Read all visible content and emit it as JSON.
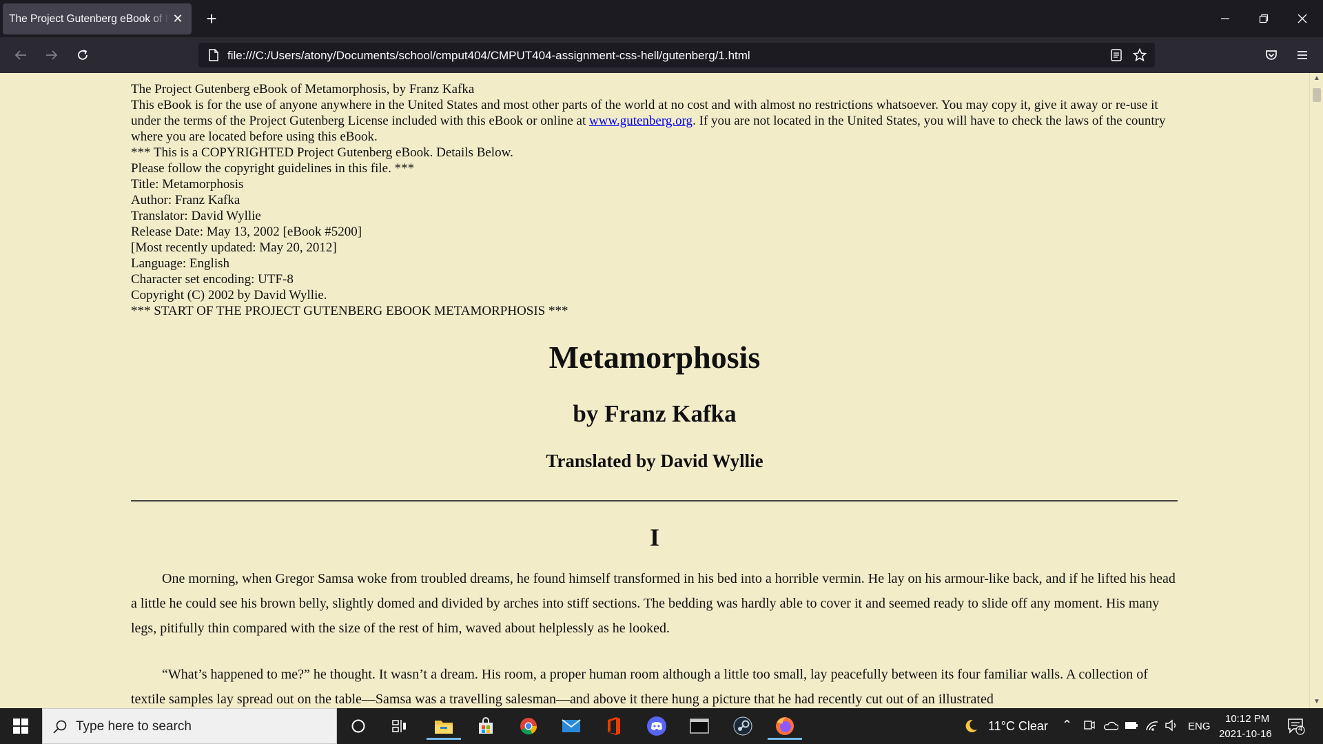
{
  "browser": {
    "tab_title": "The Project Gutenberg eBook of Metamorphosis, by Franz Kafka",
    "url": "file:///C:/Users/atony/Documents/school/cmput404/CMPUT404-assignment-css-hell/gutenberg/1.html"
  },
  "header": {
    "line1": "The Project Gutenberg eBook of Metamorphosis, by Franz Kafka",
    "license_before_link": "This eBook is for the use of anyone anywhere in the United States and most other parts of the world at no cost and with almost no restrictions whatsoever. You may copy it, give it away or re-use it under the terms of the Project Gutenberg License included with this eBook or online at ",
    "license_link": "www.gutenberg.org",
    "license_after_link": ". If you are not located in the United States, you will have to check the laws of the country where you are located before using this eBook.",
    "copyright_notice": "*** This is a COPYRIGHTED Project Gutenberg eBook. Details Below.",
    "guidelines": "Please follow the copyright guidelines in this file. ***",
    "title": "Title: Metamorphosis",
    "author": "Author: Franz Kafka",
    "translator": "Translator: David Wyllie",
    "release": "Release Date: May 13, 2002 [eBook #5200]",
    "updated": "[Most recently updated: May 20, 2012]",
    "language": "Language: English",
    "encoding": "Character set encoding: UTF-8",
    "copyright": "Copyright (C) 2002 by David Wyllie.",
    "start": "*** START OF THE PROJECT GUTENBERG EBOOK METAMORPHOSIS ***"
  },
  "book": {
    "title": "Metamorphosis",
    "byline": "by Franz Kafka",
    "translator_line": "Translated by David Wyllie",
    "chapter": "I",
    "paragraph1": "One morning, when Gregor Samsa woke from troubled dreams, he found himself transformed in his bed into a horrible vermin. He lay on his armour-like back, and if he lifted his head a little he could see his brown belly, slightly domed and divided by arches into stiff sections. The bedding was hardly able to cover it and seemed ready to slide off any moment. His many legs, pitifully thin compared with the size of the rest of him, waved about helplessly as he looked.",
    "paragraph2": "“What’s happened to me?” he thought. It wasn’t a dream. His room, a proper human room although a little too small, lay peacefully between its four familiar walls. A collection of textile samples lay spread out on the table—Samsa was a travelling salesman—and above it there hung a picture that he had recently cut out of an illustrated"
  },
  "taskbar": {
    "search_placeholder": "Type here to search",
    "weather": "11°C  Clear",
    "language": "ENG",
    "time": "10:12 PM",
    "date": "2021-10-16",
    "notification_count": "4"
  },
  "colors": {
    "page_background": "#f3ecc9",
    "chrome_dark": "#1c1b22",
    "toolbar": "#2b2a33",
    "link": "#0000ee",
    "taskbar": "#1f1f1f"
  },
  "icons": [
    "page-icon",
    "reader-view-icon",
    "bookmark-star-icon",
    "pocket-icon",
    "menu-icon",
    "back-icon",
    "forward-icon",
    "reload-icon",
    "minimize-icon",
    "restore-icon",
    "close-icon"
  ]
}
